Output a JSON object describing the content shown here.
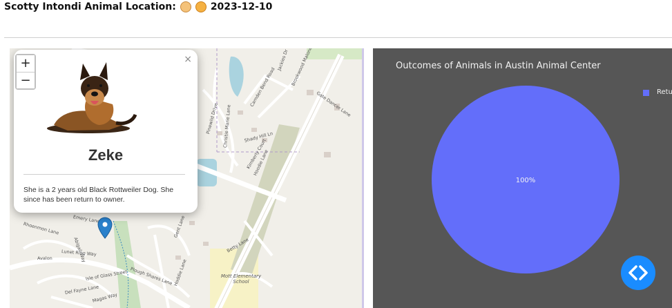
{
  "header": {
    "title": "Scotty Intondi Animal Location:",
    "date": "2023-12-10",
    "icons": [
      "dog-face-icon",
      "cat-face-icon"
    ]
  },
  "map": {
    "zoom_in_label": "+",
    "zoom_out_label": "−",
    "popup": {
      "close_label": "×",
      "animal_name": "Zeke",
      "description": "She is a 2 years old Black Rottweiler Dog. She since has been return to owner.",
      "photo_icon": "german-shepherd-photo"
    },
    "street_labels": [
      "Jackies Dr",
      "Brookwood Malone Dr",
      "Camden Bend Road",
      "Gate Dancer Lane",
      "Pinewild Drive",
      "Christie Marie Lane",
      "Shady Hill Ln",
      "Kimberly Court",
      "Hoodie Lane",
      "Emery Lane",
      "Rhoenmon Lane",
      "Avalon",
      "Lunet Ring Way",
      "Isle of Glass Street",
      "Plough Shares Lane",
      "Hoddie Lane",
      "Del Fayne Lane",
      "Betty Lane",
      "Magas Way",
      "Abigail Way",
      "Gent Lane"
    ],
    "school_label": "Mott Elementary School"
  },
  "chart_data": {
    "type": "pie",
    "title": "Outcomes of Animals in Austin Animal Center",
    "categories": [
      "Return to Owner"
    ],
    "values": [
      100
    ],
    "slice_labels": [
      "100%"
    ],
    "legend": {
      "visible_text": "Retu",
      "placement": "right"
    },
    "colors": {
      "slice": "#636efa",
      "background": "#565656",
      "text": "#f2f2f2"
    }
  },
  "controls": {
    "code_toggle_icon": "code-brackets-icon"
  }
}
